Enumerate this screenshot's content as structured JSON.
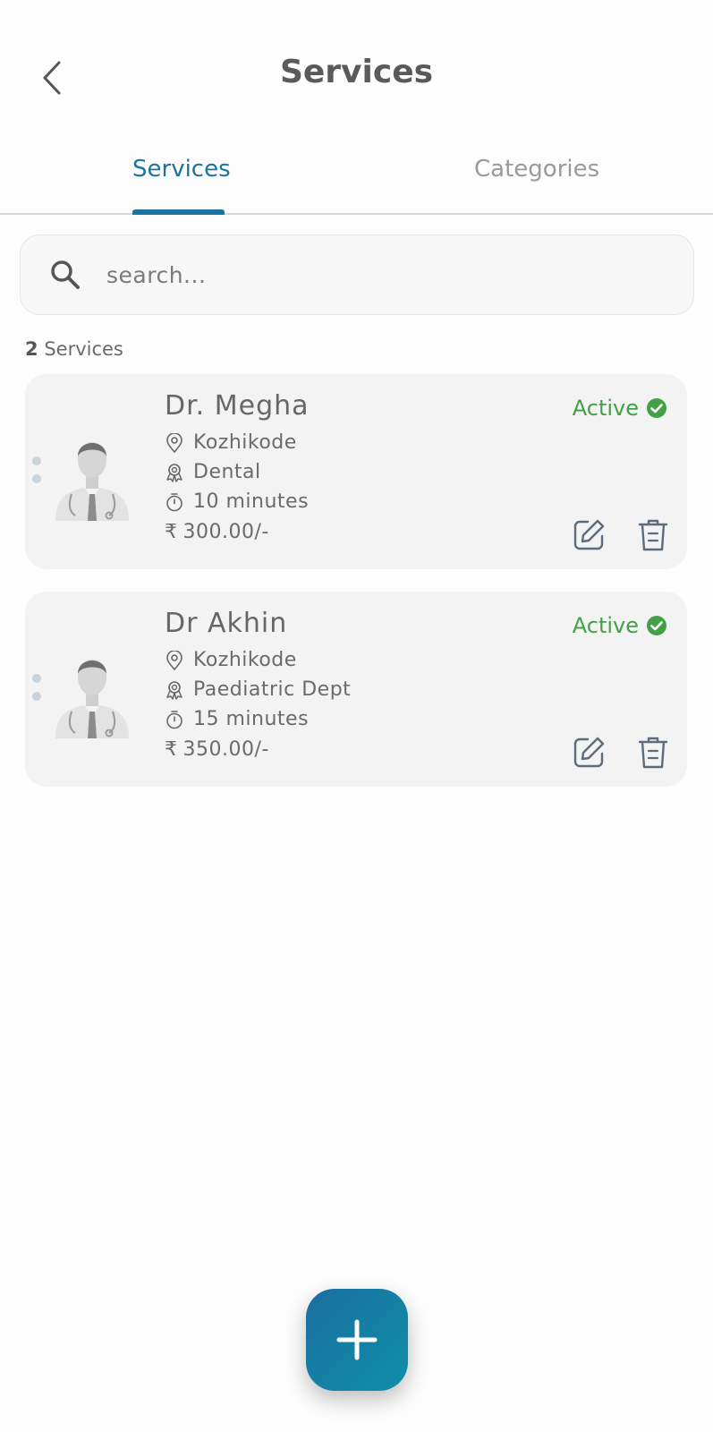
{
  "header": {
    "title": "Services"
  },
  "tabs": [
    {
      "label": "Services",
      "active": true
    },
    {
      "label": "Categories",
      "active": false
    }
  ],
  "search": {
    "placeholder": "search..."
  },
  "summary": {
    "count": "2",
    "label": "Services"
  },
  "services": [
    {
      "name": "Dr. Megha",
      "status": "Active",
      "location": "Kozhikode",
      "department": "Dental",
      "duration": "10 minutes",
      "currency": "₹",
      "price": "300.00/-"
    },
    {
      "name": "Dr Akhin",
      "status": "Active",
      "location": "Kozhikode",
      "department": "Paediatric Dept",
      "duration": "15 minutes",
      "currency": "₹",
      "price": "350.00/-"
    }
  ],
  "colors": {
    "accent": "#1b74a0",
    "active_status": "#43a047",
    "fab_gradient_start": "#1a6fa0",
    "fab_gradient_end": "#0f8fa8"
  },
  "icons": {
    "back": "chevron-left-icon",
    "search": "search-icon",
    "location": "location-pin-icon",
    "department": "award-badge-icon",
    "duration": "stopwatch-icon",
    "status": "check-circle-icon",
    "edit": "edit-icon",
    "delete": "trash-icon",
    "fab": "plus-icon"
  }
}
